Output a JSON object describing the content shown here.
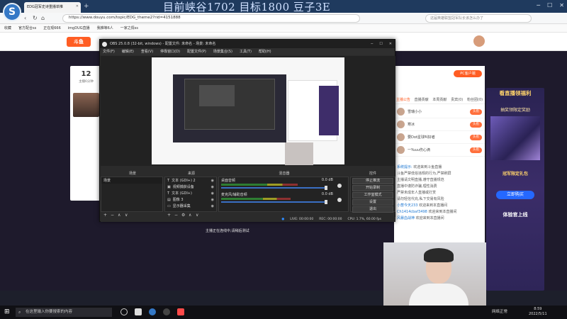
{
  "browser": {
    "tab_title": "EDG冠军史诗重播单推",
    "url": "https://www.douyu.com/topic/EDG_theme2?rid=4151888",
    "search_placeholder": "这届英雄联盟冠军队长该怎么办了",
    "bookmarks": [
      "收藏",
      "官方配合ss",
      "正在观666",
      "imgDUG直播",
      "我推等6人",
      "一家之情ss"
    ],
    "overlay_title": "目前峡谷1702 目标1800 豆子3E"
  },
  "page": {
    "site_logo": "斗鱼",
    "level_value": "12",
    "level_label": "主播6分钟",
    "pc_button": "PC客户端",
    "right_tabs": [
      "主播公告",
      "直播贡献",
      "本周贡献",
      "贵宾(0)",
      "粉丝团(0)"
    ],
    "rank_rows": [
      {
        "name": "雪瑞小小",
        "badge": "头衔"
      },
      {
        "name": "寒冰",
        "badge": "头衔"
      },
      {
        "name": "要Dot星球叫好者",
        "badge": "头衔"
      },
      {
        "name": "一Yuuu伤心滴",
        "badge": "头衔"
      }
    ],
    "chat_lines": [
      {
        "name": "系统提示:",
        "text": "欢迎来到斗鱼直播"
      },
      {
        "name": "",
        "text": "斗鱼严禁低俗违规的行为,严禁刷屏"
      },
      {
        "name": "",
        "text": "主播请文明直播,遵守直播规范"
      },
      {
        "name": "",
        "text": "直播中谨防诈骗,理性消费"
      },
      {
        "name": "",
        "text": "严禁未成年人直播或打赏"
      },
      {
        "name": "",
        "text": "请勿轻信代充,私下交易有风险"
      },
      {
        "name": "小葱今天233",
        "text": "欢迎来到本直播间"
      },
      {
        "name": "Ch1414cbaf3498",
        "text": "欢迎来到本直播间"
      },
      {
        "name": "风暴血战神",
        "text": "欢迎来到本直播间"
      }
    ],
    "ad": {
      "title": "看直播领福利",
      "subtitle": "抽奖领限定奖励",
      "gift": "冠军限定礼包",
      "button": "立即购买",
      "footer": "体验官上线"
    },
    "bottom_text": "首页"
  },
  "obs": {
    "title": "OBS 25.0.8 (32-bit, windows) - 配置文件: 未命名 - 场景: 未命名",
    "menu": [
      "文件(F)",
      "编辑(E)",
      "查看(V)",
      "停靠窗口(D)",
      "配置文件(P)",
      "场景集合(S)",
      "工具(T)",
      "帮助(H)"
    ],
    "dock_headers": [
      "场景",
      "来源",
      "混音器",
      "控件"
    ],
    "scenes": [
      "场景"
    ],
    "sources": [
      "文本 (GDI+) 2",
      "视频捕获设备",
      "文本 (GDI+)",
      "图像 3",
      "显示器采集"
    ],
    "mixer": [
      {
        "name": "桌面音频",
        "db": "0.0 dB",
        "level": 0.72
      },
      {
        "name": "麦克风/辅助音频",
        "db": "0.0 dB",
        "level": 0.65
      }
    ],
    "controls": [
      "停止推流",
      "开始录制",
      "工作室模式",
      "设置",
      "退出"
    ],
    "status": {
      "live": "LIVE: 00:00:00",
      "rec": "REC: 00:00:00",
      "cpu": "CPU: 1.7%, 60.00 fps"
    },
    "caption": "主播正在连线中,请稍后测试"
  },
  "taskbar": {
    "search_placeholder": "在这里输入你要搜索的内容",
    "tray_text": "网络正常",
    "time": "8:59",
    "date": "2022/5/11"
  }
}
